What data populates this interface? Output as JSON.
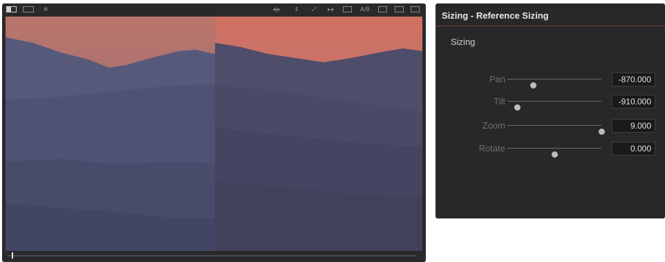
{
  "viewer": {
    "toolbar_icons": [
      {
        "name": "single-viewer-icon"
      },
      {
        "name": "cinema-mode-icon"
      },
      {
        "name": "highlight-wand-icon"
      },
      {
        "name": "split-wipe-icon"
      },
      {
        "name": "flip-vertical-icon"
      },
      {
        "name": "expand-icon"
      },
      {
        "name": "frame-step-icon"
      },
      {
        "name": "mirror-icon"
      },
      {
        "name": "ab-label",
        "label": "A/B"
      },
      {
        "name": "grid-icon"
      },
      {
        "name": "vertical-wipe-icon"
      },
      {
        "name": "box-wipe-icon"
      }
    ],
    "playhead_position": 0.01
  },
  "panel": {
    "title": "Sizing - Reference Sizing",
    "section": "Sizing",
    "accent_color": "#7a3d32",
    "controls": [
      {
        "key": "pan",
        "label": "Pan",
        "value": "-870.000",
        "slider": 0.27
      },
      {
        "key": "tilt",
        "label": "Tilt",
        "value": "-910.000",
        "slider": 0.1
      },
      {
        "key": "zoom",
        "label": "Zoom",
        "value": "9.000",
        "slider": 1.0
      },
      {
        "key": "rotate",
        "label": "Rotate",
        "value": "0.000",
        "slider": 0.5
      }
    ]
  }
}
